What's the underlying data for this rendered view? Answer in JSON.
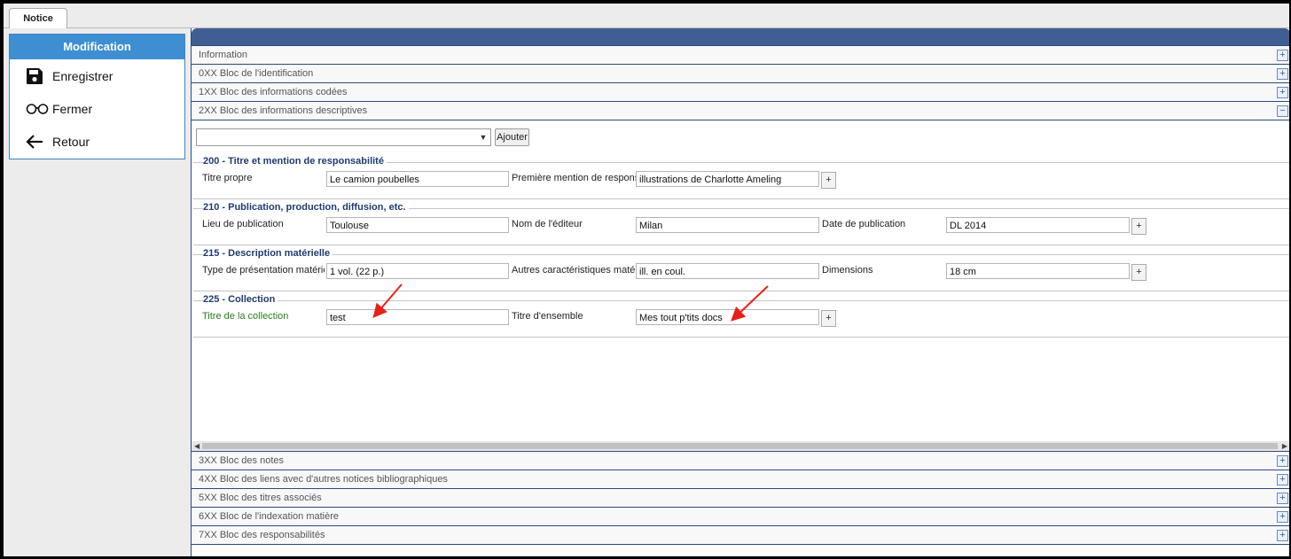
{
  "tab": {
    "label": "Notice"
  },
  "left": {
    "header": "Modification",
    "items": [
      {
        "label": "Enregistrer",
        "icon": "floppy-disk-icon"
      },
      {
        "label": "Fermer",
        "icon": "glasses-icon"
      },
      {
        "label": "Retour",
        "icon": "arrow-left-icon"
      }
    ]
  },
  "sections_top": [
    {
      "label": "Information",
      "toggle": "+"
    },
    {
      "label": "0XX Bloc de l'identification",
      "toggle": "+"
    },
    {
      "label": "1XX Bloc des informations codées",
      "toggle": "+"
    },
    {
      "label": "2XX Bloc des informations descriptives",
      "toggle": "−"
    }
  ],
  "toolbar": {
    "select_value": "",
    "add_label": "Ajouter"
  },
  "fieldsets": {
    "f200": {
      "legend": "200 - Titre et mention de responsabilité",
      "l1": "Titre propre",
      "v1": "Le camion poubelles",
      "l2": "Première mention de responsabilité",
      "v2": "illustrations de Charlotte Ameling"
    },
    "f210": {
      "legend": "210 - Publication, production, diffusion, etc.",
      "l1": "Lieu de publication",
      "v1": "Toulouse",
      "l2": "Nom de l'éditeur",
      "v2": "Milan",
      "l3": "Date de publication",
      "v3": "DL 2014"
    },
    "f215": {
      "legend": "215 - Description matérielle",
      "l1": "Type de présentation matérielle",
      "v1": "1 vol. (22 p.)",
      "l2": "Autres caractéristiques matérielles",
      "v2": "ill. en coul.",
      "l3": "Dimensions",
      "v3": "18 cm"
    },
    "f225": {
      "legend": "225 - Collection",
      "l1": "Titre de la collection",
      "v1": "test",
      "l2": "Titre d'ensemble",
      "v2": "Mes tout p'tits docs"
    }
  },
  "plus_label": "+",
  "sections_bottom": [
    {
      "label": "3XX Bloc des notes",
      "toggle": "+"
    },
    {
      "label": "4XX Bloc des liens avec d'autres notices bibliographiques",
      "toggle": "+"
    },
    {
      "label": "5XX Bloc des titres associés",
      "toggle": "+"
    },
    {
      "label": "6XX Bloc de l'indexation matière",
      "toggle": "+"
    },
    {
      "label": "7XX Bloc des responsabilités",
      "toggle": "+"
    }
  ],
  "colors": {
    "accent": "#3d8fd1",
    "header": "#3f5e93",
    "annotation_arrow": "#e8201a"
  }
}
